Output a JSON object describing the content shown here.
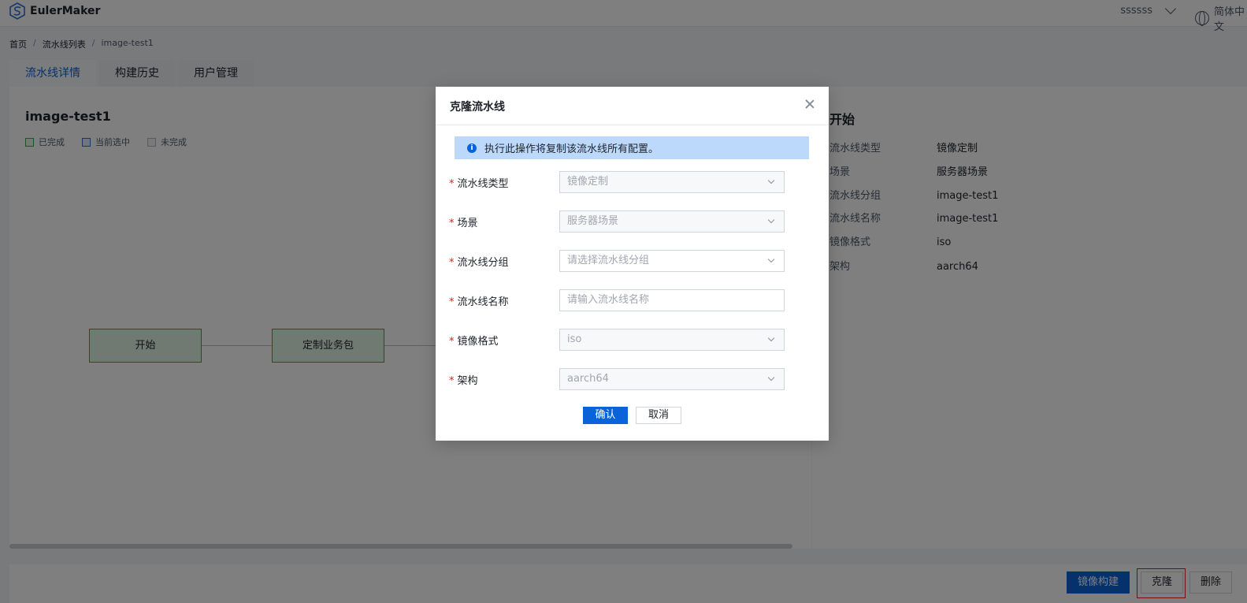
{
  "app": {
    "name": "EulerMaker",
    "user": "ssssss",
    "language": "简体中文"
  },
  "breadcrumb": [
    "首页",
    "流水线列表",
    "image-test1"
  ],
  "tabs": [
    {
      "label": "流水线详情",
      "active": true
    },
    {
      "label": "构建历史",
      "active": false
    },
    {
      "label": "用户管理",
      "active": false
    }
  ],
  "pipeline": {
    "title": "image-test1",
    "legend": [
      "已完成",
      "当前选中",
      "未完成"
    ],
    "nodes": [
      "开始",
      "定制业务包"
    ]
  },
  "details": {
    "title": "开始",
    "items": [
      {
        "key": "流水线类型",
        "value": "镜像定制"
      },
      {
        "key": "场景",
        "value": "服务器场景"
      },
      {
        "key": "流水线分组",
        "value": "image-test1"
      },
      {
        "key": "流水线名称",
        "value": "image-test1"
      },
      {
        "key": "镜像格式",
        "value": "iso"
      },
      {
        "key": "架构",
        "value": "aarch64"
      }
    ]
  },
  "actions": {
    "build": "镜像构建",
    "clone": "克隆",
    "delete": "删除"
  },
  "modal": {
    "title": "克隆流水线",
    "alert": "执行此操作将复制该流水线所有配置。",
    "fields": [
      {
        "label": "流水线类型",
        "value": "镜像定制"
      },
      {
        "label": "场景",
        "value": "服务器场景"
      },
      {
        "label": "流水线分组",
        "placeholder": "请选择流水线分组"
      },
      {
        "label": "流水线名称",
        "placeholder": "请输入流水线名称"
      },
      {
        "label": "镜像格式",
        "value": "iso"
      },
      {
        "label": "架构",
        "value": "aarch64"
      }
    ],
    "required_mark": "*",
    "confirm": "确认",
    "cancel": "取消"
  },
  "colors": {
    "primary": "#0a63d8",
    "success": "#3aa54a",
    "danger": "#e02020"
  }
}
